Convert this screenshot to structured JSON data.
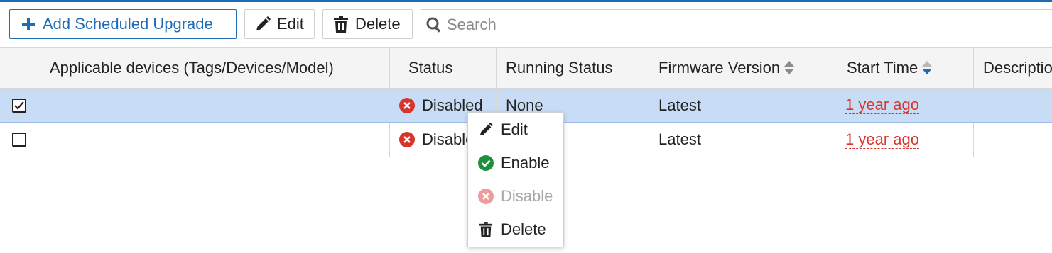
{
  "toolbar": {
    "add_label": "Add Scheduled Upgrade",
    "edit_label": "Edit",
    "delete_label": "Delete",
    "search_placeholder": "Search",
    "accent_color": "#1f6bb5"
  },
  "table": {
    "columns": [
      {
        "label": ""
      },
      {
        "label": "Applicable devices (Tags/Devices/Model)"
      },
      {
        "label": "Status"
      },
      {
        "label": "Running Status"
      },
      {
        "label": "Firmware Version",
        "sort": "sortable"
      },
      {
        "label": "Start Time",
        "sort": "descending"
      },
      {
        "label": "Description"
      }
    ],
    "rows": [
      {
        "selected": true,
        "devices": "",
        "status": "Disabled",
        "running_status": "None",
        "firmware": "Latest",
        "start_time": "1 year ago",
        "description": ""
      },
      {
        "selected": false,
        "devices": "",
        "status": "Disabled",
        "running_status": "",
        "firmware": "Latest",
        "start_time": "1 year ago",
        "description": ""
      }
    ],
    "selected_row_color": "#c8dcf5",
    "status_color": "#d9342b"
  },
  "context_menu": {
    "items": [
      {
        "label": "Edit",
        "icon": "pencil-icon",
        "enabled": true
      },
      {
        "label": "Enable",
        "icon": "check-circle-icon",
        "enabled": true
      },
      {
        "label": "Disable",
        "icon": "x-circle-icon",
        "enabled": false
      },
      {
        "label": "Delete",
        "icon": "trash-icon",
        "enabled": true
      }
    ]
  }
}
